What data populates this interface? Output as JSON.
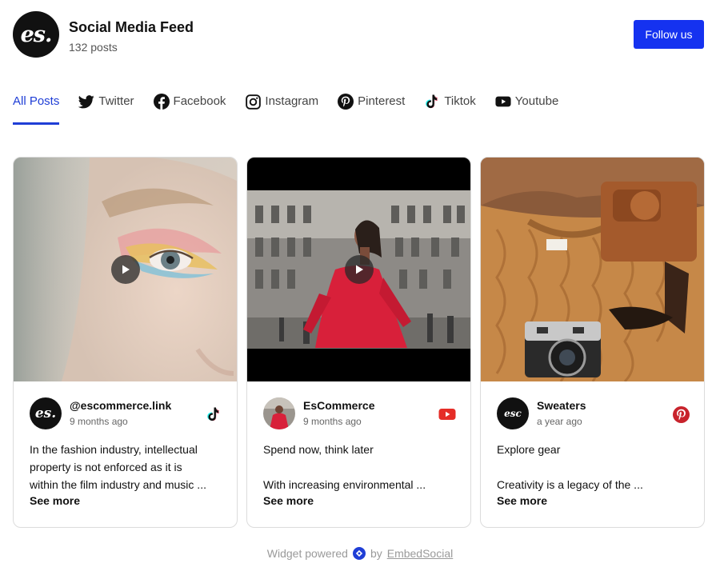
{
  "header": {
    "logo_text": "es.",
    "title": "Social Media Feed",
    "post_count": "132 posts",
    "follow_label": "Follow us"
  },
  "tabs": [
    {
      "label": "All Posts",
      "icon": "none",
      "active": true
    },
    {
      "label": "Twitter",
      "icon": "twitter-icon"
    },
    {
      "label": "Facebook",
      "icon": "facebook-icon"
    },
    {
      "label": "Instagram",
      "icon": "instagram-icon"
    },
    {
      "label": "Pinterest",
      "icon": "pinterest-icon"
    },
    {
      "label": "Tiktok",
      "icon": "tiktok-icon"
    },
    {
      "label": "Youtube",
      "icon": "youtube-icon"
    }
  ],
  "posts": [
    {
      "author": "@escommerce.link",
      "avatar_text": "es.",
      "time": "9 months ago",
      "network": "tiktok-icon",
      "has_video": true,
      "lines": [
        "In the fashion industry, intellectual",
        "property is not enforced as it is",
        "within the film industry and music ..."
      ],
      "see_more": "See more"
    },
    {
      "author": "EsCommerce",
      "avatar_text": "",
      "time": "9 months ago",
      "network": "youtube-icon",
      "has_video": true,
      "lines": [
        "Spend now, think later",
        "",
        "With increasing environmental ..."
      ],
      "see_more": "See more"
    },
    {
      "author": "Sweaters",
      "avatar_text": "esc",
      "time": "a year ago",
      "network": "pinterest-icon",
      "has_video": false,
      "lines": [
        "Explore gear",
        "",
        "Creativity is a legacy of the ..."
      ],
      "see_more": "See more"
    }
  ],
  "footer": {
    "prefix": "Widget powered",
    "by": "by",
    "link": "EmbedSocial"
  },
  "colors": {
    "accent": "#1f3ed6",
    "follow_button": "#1532f0",
    "youtube": "#e52d27",
    "pinterest": "#c8232c"
  }
}
